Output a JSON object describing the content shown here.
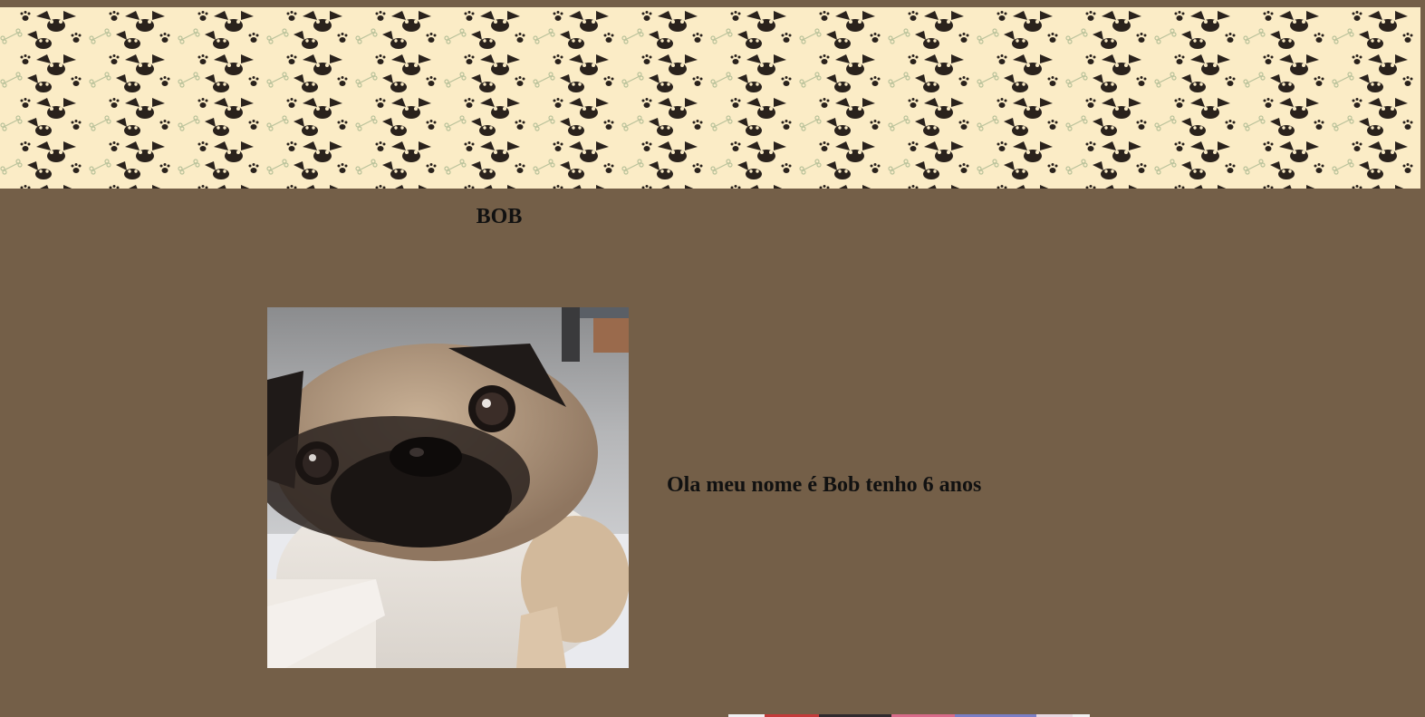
{
  "banner": {
    "icon": "pug-paw-pattern",
    "colors": {
      "background": "#fbecc6",
      "print": "#2a221c",
      "bone": "#b9c29a"
    }
  },
  "page": {
    "background": "#745f48"
  },
  "profile": {
    "title": "BOB",
    "intro": "Ola meu nome é Bob tenho 6 anos",
    "photo_icon": "pug-photo",
    "next_photo_icon": "dog-photo"
  }
}
